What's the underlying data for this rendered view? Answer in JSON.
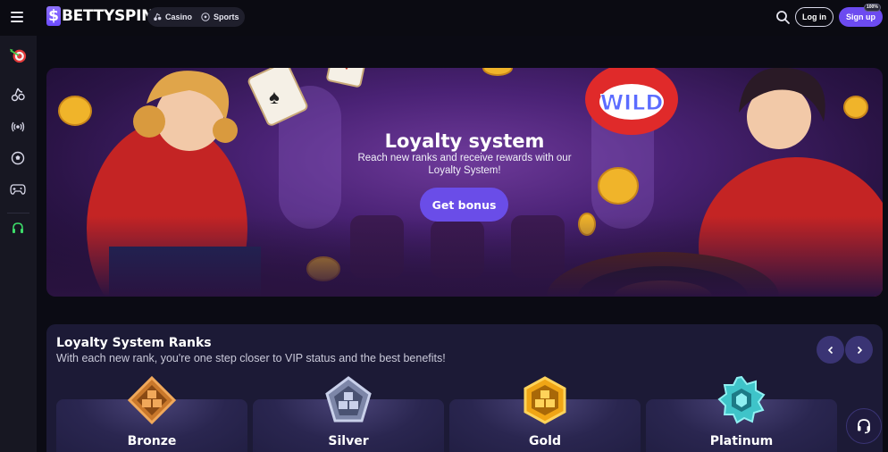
{
  "header": {
    "logo_letter": "$",
    "logo_text": "BETTYSPIN",
    "nav": [
      {
        "label": "Casino",
        "icon": "cherries-icon"
      },
      {
        "label": "Sports",
        "icon": "soccer-ball-icon"
      }
    ],
    "login_label": "Log in",
    "signup_label": "Sign up",
    "signup_badge": "100%"
  },
  "sidebar": {
    "items": [
      {
        "icon": "dartboard-icon"
      },
      {
        "icon": "cherries-icon"
      },
      {
        "icon": "live-broadcast-icon"
      },
      {
        "icon": "soccer-ball-icon"
      },
      {
        "icon": "gamepad-icon"
      },
      {
        "icon": "headset-icon"
      }
    ]
  },
  "hero": {
    "title": "Loyalty system",
    "subtitle": "Reach new ranks and receive rewards with our Loyalty System!",
    "button_label": "Get bonus"
  },
  "ranks": {
    "title": "Loyalty System Ranks",
    "subtitle": "With each new rank, you're one step closer to VIP status and the best benefits!",
    "cards": [
      {
        "name": "Bronze",
        "color": "#c9782b"
      },
      {
        "name": "Silver",
        "color": "#9aa3c4"
      },
      {
        "name": "Gold",
        "color": "#f0a515"
      },
      {
        "name": "Platinum",
        "color": "#3fc4c9"
      }
    ]
  },
  "colors": {
    "accent": "#6c4bf0",
    "background": "#0b0b14",
    "panel": "#1c1a36"
  }
}
